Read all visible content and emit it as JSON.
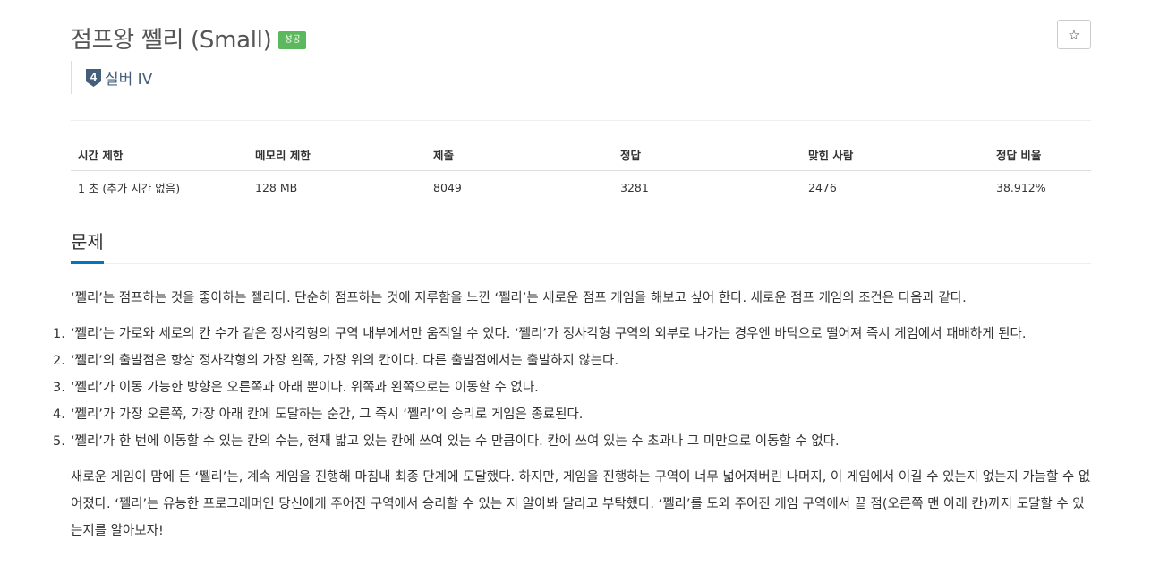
{
  "problem": {
    "title": "점프왕 쩰리 (Small)",
    "badge": "성공",
    "tier": {
      "number": "4",
      "label": "실버 IV",
      "color": "#435f7a"
    },
    "star_symbol": "☆"
  },
  "info_table": {
    "headers": [
      "시간 제한",
      "메모리 제한",
      "제출",
      "정답",
      "맞힌 사람",
      "정답 비율"
    ],
    "values": [
      "1 초 (추가 시간 없음)",
      "128 MB",
      "8049",
      "3281",
      "2476",
      "38.912%"
    ]
  },
  "section": {
    "title": "문제"
  },
  "description": {
    "intro": "‘쩰리’는 점프하는 것을 좋아하는 젤리다. 단순히 점프하는 것에 지루함을 느낀 ‘쩰리’는 새로운 점프 게임을 해보고 싶어 한다. 새로운 점프 게임의 조건은 다음과 같다.",
    "rules": [
      {
        "num": "1.",
        "text": "‘쩰리’는 가로와 세로의 칸 수가 같은 정사각형의 구역 내부에서만 움직일 수 있다. ‘쩰리’가 정사각형 구역의 외부로 나가는 경우엔 바닥으로 떨어져 즉시 게임에서 패배하게 된다."
      },
      {
        "num": "2.",
        "text": "‘쩰리’의 출발점은 항상 정사각형의 가장 왼쪽, 가장 위의 칸이다. 다른 출발점에서는 출발하지 않는다."
      },
      {
        "num": "3.",
        "text": "‘쩰리’가 이동 가능한 방향은 오른쪽과 아래 뿐이다. 위쪽과 왼쪽으로는 이동할 수 없다."
      },
      {
        "num": "4.",
        "text": "‘쩰리’가 가장 오른쪽, 가장 아래 칸에 도달하는 순간, 그 즉시 ‘쩰리’의 승리로 게임은 종료된다."
      },
      {
        "num": "5.",
        "text": "‘쩰리’가 한 번에 이동할 수 있는 칸의 수는, 현재 밟고 있는 칸에 쓰여 있는 수 만큼이다. 칸에 쓰여 있는 수 초과나 그 미만으로 이동할 수 없다."
      }
    ],
    "outro": "새로운 게임이 맘에 든 ‘쩰리’는, 계속 게임을 진행해 마침내 최종 단계에 도달했다. 하지만, 게임을 진행하는 구역이 너무 넓어져버린 나머지, 이 게임에서 이길 수 있는지 없는지 가늠할 수 없어졌다. ‘쩰리’는 유능한 프로그래머인 당신에게 주어진 구역에서 승리할 수 있는 지 알아봐 달라고 부탁했다. ‘쩰리’를 도와 주어진 게임 구역에서 끝 점(오른쪽 맨 아래 칸)까지 도달할 수 있는지를 알아보자!"
  },
  "colors": {
    "badge_success": "#5cb85c",
    "section_underline": "#0076c0",
    "tier_silver": "#435f7a"
  },
  "icons": {
    "tier": "silver-tier-icon",
    "star": "star-outline-icon"
  }
}
